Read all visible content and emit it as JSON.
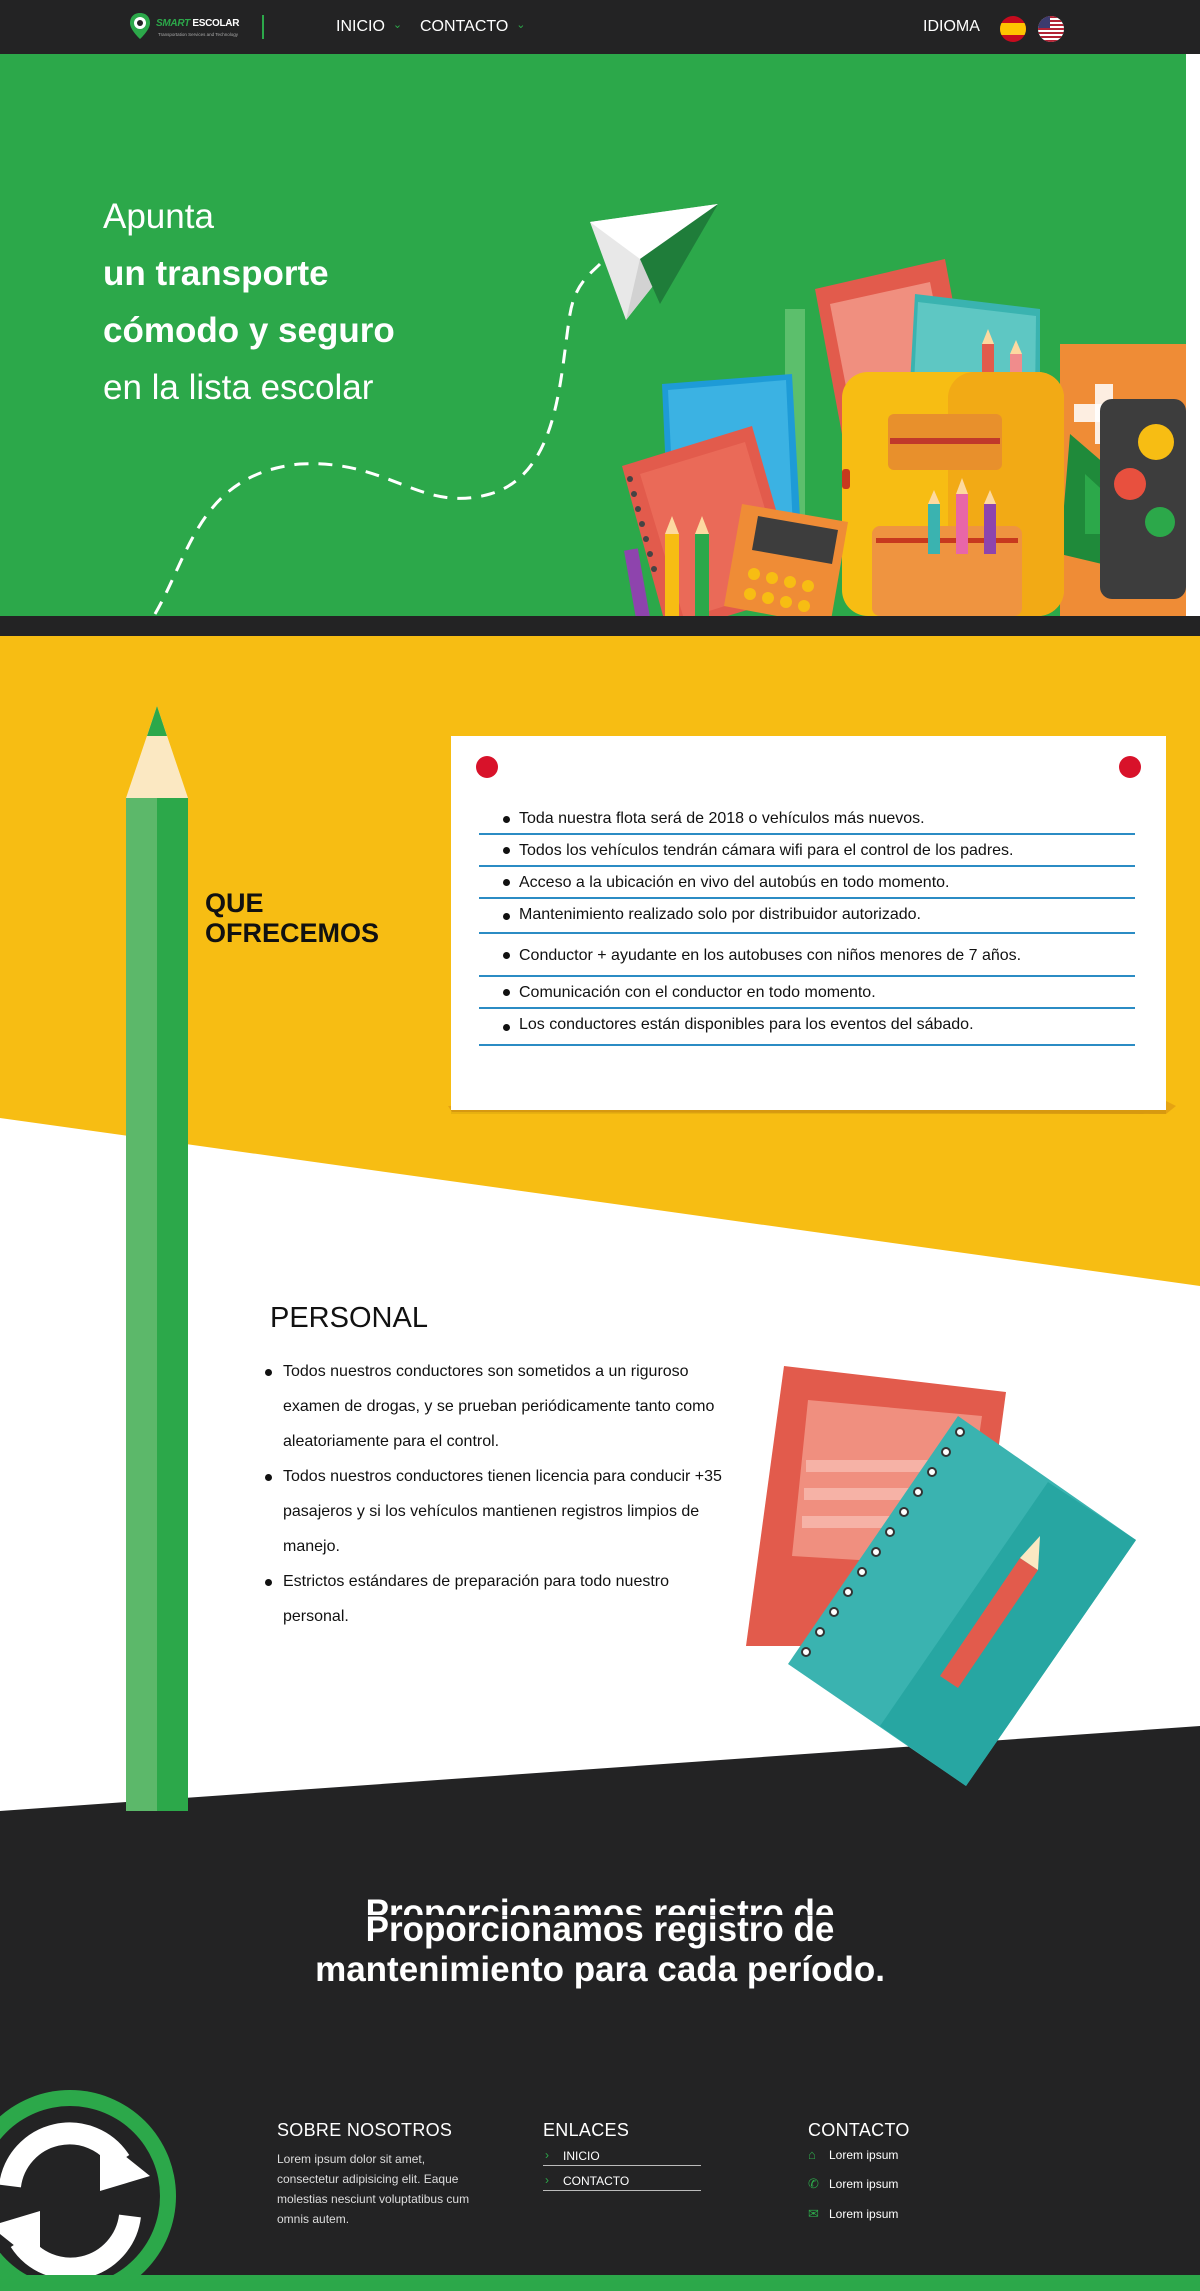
{
  "nav": {
    "logo_smart": "SMART",
    "logo_escolar": "ESCOLAR",
    "logo_tagline": "Transportation Services and Technology",
    "items": [
      {
        "label": "INICIO"
      },
      {
        "label": "CONTACTO"
      }
    ],
    "idioma": "IDIOMA",
    "flags": [
      "spain-flag-icon",
      "usa-flag-icon"
    ]
  },
  "hero": {
    "line1": "Apunta",
    "line2": "un transporte",
    "line3": "cómodo y seguro",
    "line4": "en la lista escolar"
  },
  "offer": {
    "title_line1": "QUE",
    "title_line2": "OFRECEMOS",
    "items": [
      "Toda nuestra flota será de 2018 o vehículos más nuevos.",
      "Todos los vehículos tendrán cámara wifi para el control de los padres.",
      "Acceso a la ubicación en vivo del autobús en todo momento.",
      "Mantenimiento realizado solo por distribuidor autorizado.",
      "Conductor + ayudante en los autobuses con niños menores de 7 años.",
      "Comunicación con el conductor en todo momento.",
      "Los conductores están disponibles para los eventos del sábado."
    ]
  },
  "personal": {
    "title": "PERSONAL",
    "items": [
      "Todos nuestros conductores son sometidos a un riguroso examen de drogas, y se prueban periódicamente tanto como aleatoriamente para el control.",
      "Todos nuestros conductores tienen licencia para conducir +35 pasajeros y si los vehículos mantienen registros limpios de manejo.",
      "Estrictos estándares de preparación para todo nuestro personal."
    ]
  },
  "cta": {
    "line1": "Proporcionamos registro de",
    "line2": "mantenimiento para cada período."
  },
  "footer": {
    "about_title": "SOBRE NOSOTROS",
    "about_text": "Lorem ipsum dolor sit amet, consectetur adipisicing elit. Eaque molestias nesciunt voluptatibus cum omnis autem.",
    "links_title": "ENLACES",
    "links": [
      "INICIO",
      "CONTACTO"
    ],
    "contact_title": "CONTACTO",
    "contacts": [
      {
        "icon": "home-icon",
        "text": "Lorem ipsum"
      },
      {
        "icon": "phone-icon",
        "text": "Lorem ipsum"
      },
      {
        "icon": "envelope-icon",
        "text": "Lorem ipsum"
      }
    ]
  },
  "colors": {
    "green": "#2ca84a",
    "yellow": "#f7bd13",
    "dark": "#232324",
    "list_line": "#2b8cc4",
    "pin_red": "#d8122a"
  }
}
